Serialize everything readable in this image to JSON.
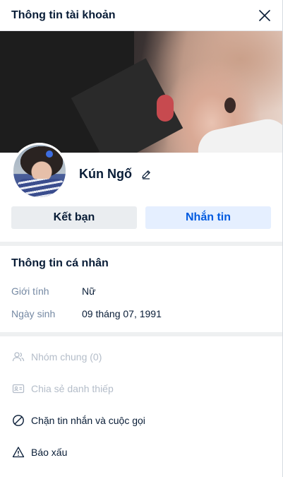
{
  "header": {
    "title": "Thông tin tài khoản"
  },
  "profile": {
    "name": "Kún Ngố"
  },
  "actions": {
    "friend_label": "Kết bạn",
    "message_label": "Nhắn tin"
  },
  "personal_info": {
    "title": "Thông tin cá nhân",
    "rows": [
      {
        "label": "Giới tính",
        "value": "Nữ"
      },
      {
        "label": "Ngày sinh",
        "value": "09 tháng 07, 1991"
      }
    ]
  },
  "menu": [
    {
      "label": "Nhóm chung (0)",
      "icon": "group-icon",
      "enabled": false
    },
    {
      "label": "Chia sẻ danh thiếp",
      "icon": "contact-card-icon",
      "enabled": false
    },
    {
      "label": "Chặn tin nhắn và cuộc gọi",
      "icon": "block-icon",
      "enabled": true
    },
    {
      "label": "Báo xấu",
      "icon": "warning-icon",
      "enabled": true
    }
  ],
  "colors": {
    "primary_text": "#081c36",
    "secondary_text": "#7589a3",
    "disabled_text": "#b4bdc9",
    "accent_blue": "#005ae0",
    "accent_blue_bg": "#e5efff"
  }
}
